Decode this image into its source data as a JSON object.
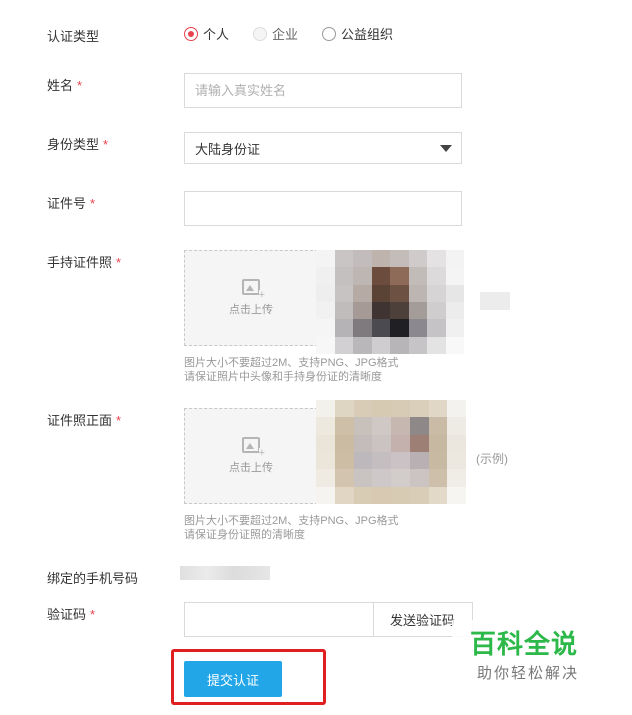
{
  "cert_type": {
    "label": "认证类型",
    "options": [
      {
        "text": "个人",
        "state": "checked"
      },
      {
        "text": "企业",
        "state": "disabled"
      },
      {
        "text": "公益组织",
        "state": "unchecked"
      }
    ]
  },
  "name": {
    "label": "姓名",
    "required_mark": "*",
    "placeholder": "请输入真实姓名"
  },
  "id_type": {
    "label": "身份类型",
    "required_mark": "*",
    "selected": "大陆身份证"
  },
  "id_number": {
    "label": "证件号",
    "required_mark": "*",
    "value": ""
  },
  "handheld_photo": {
    "label": "手持证件照",
    "required_mark": "*",
    "upload_text": "点击上传",
    "hint_line1": "图片大小不要超过2M、支持PNG、JPG格式",
    "hint_line2": "请保证照片中头像和手持身份证的清晰度"
  },
  "front_photo": {
    "label": "证件照正面",
    "required_mark": "*",
    "upload_text": "点击上传",
    "example_text": "(示例)",
    "hint_line1": "图片大小不要超过2M、支持PNG、JPG格式",
    "hint_line2": "请保证身份证照的清晰度"
  },
  "phone": {
    "label": "绑定的手机号码"
  },
  "verify_code": {
    "label": "验证码",
    "required_mark": "*",
    "value": "",
    "send_button": "发送验证码"
  },
  "submit": {
    "label": "提交认证"
  },
  "watermark": {
    "title": "百科全说",
    "subtitle": "助你轻松解决"
  },
  "colors": {
    "required": "#e8434c",
    "primary_button": "#22a6e8",
    "highlight_box": "#e02020",
    "watermark_green": "#2db84a"
  }
}
